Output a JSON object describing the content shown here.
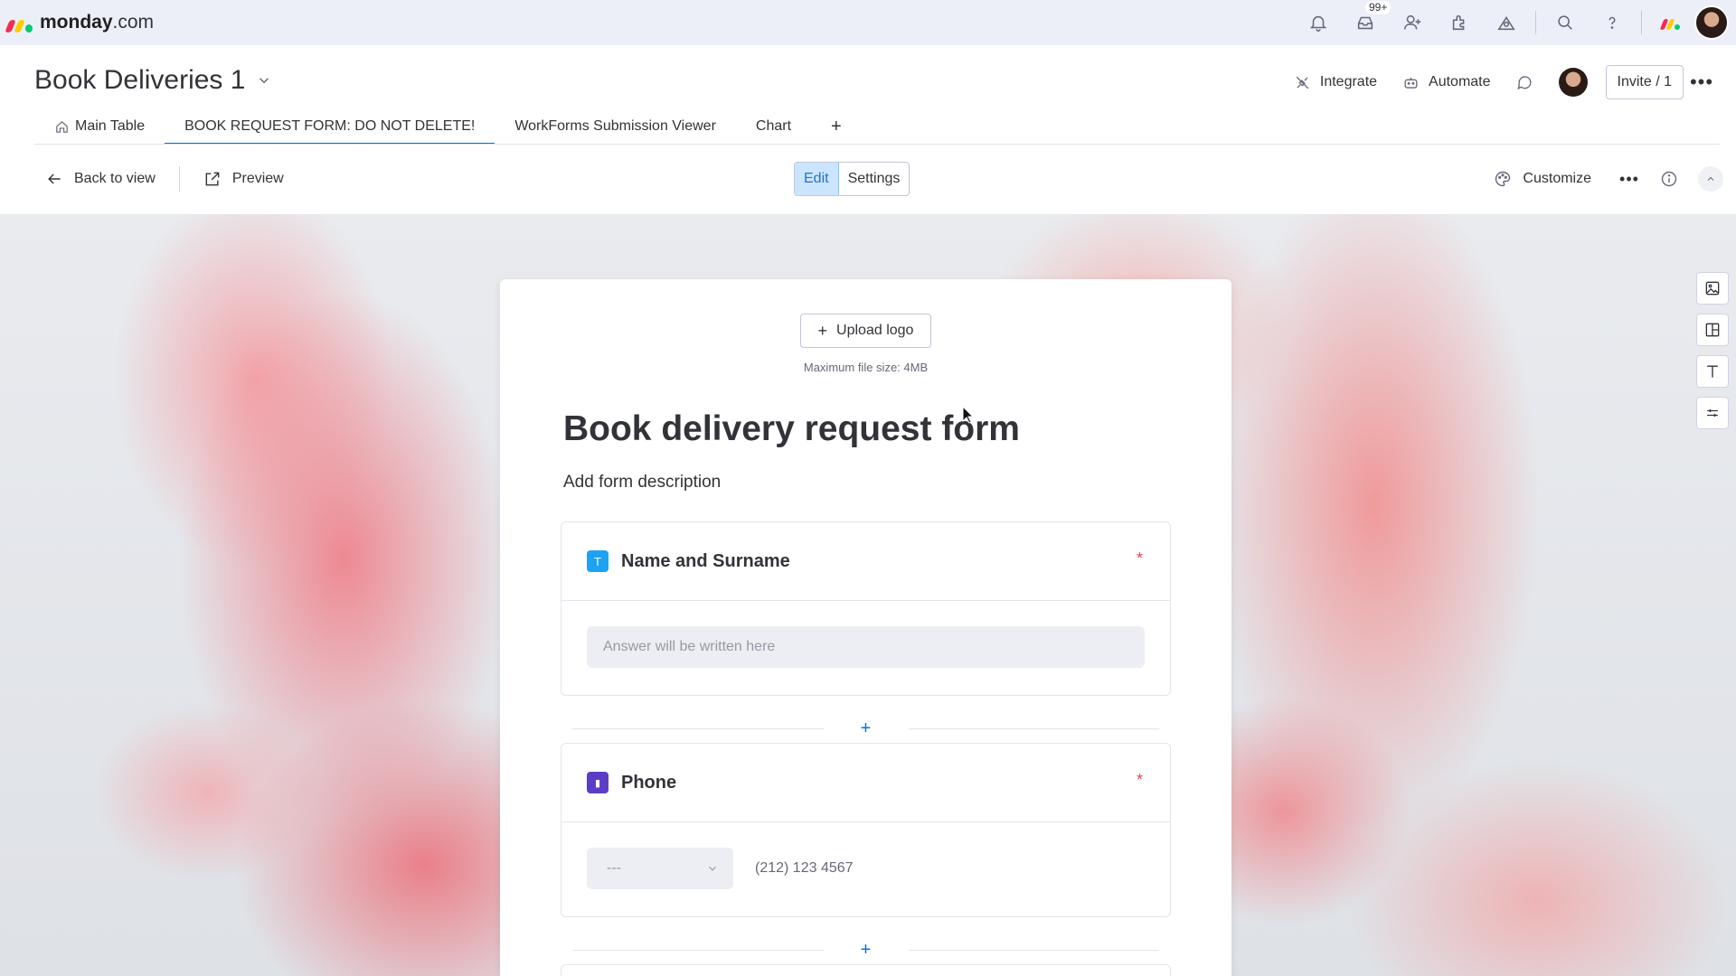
{
  "app": {
    "brand_name": "monday",
    "brand_suffix": ".com",
    "notifications_badge": "99+"
  },
  "board": {
    "title": "Book Deliveries 1",
    "actions": {
      "integrate": "Integrate",
      "automate": "Automate",
      "invite": "Invite / 1"
    }
  },
  "tabs": [
    {
      "label": "Main Table",
      "icon": "home-icon",
      "active": false
    },
    {
      "label": "BOOK REQUEST FORM: DO NOT DELETE!",
      "active": true
    },
    {
      "label": "WorkForms Submission Viewer",
      "active": false
    },
    {
      "label": "Chart",
      "active": false
    },
    {
      "label": "+",
      "active": false
    }
  ],
  "toolbar": {
    "back": "Back to view",
    "preview": "Preview",
    "edit": "Edit",
    "settings": "Settings",
    "customize": "Customize"
  },
  "form": {
    "upload_logo": "Upload logo",
    "max_file_size": "Maximum file size: 4MB",
    "title": "Book delivery request form",
    "description": "Add form description",
    "questions": [
      {
        "label": "Name and Surname",
        "required_mark": "*",
        "placeholder": "Answer will be written here",
        "icon_color": "#1ca3f4",
        "icon_glyph": "T"
      },
      {
        "label": "Phone",
        "required_mark": "*",
        "country_placeholder": "---",
        "phone_placeholder": "(212) 123 4567",
        "icon_color": "#5b3ec8",
        "icon_glyph": "▮"
      }
    ]
  },
  "colors": {
    "accent": "#0073ea",
    "required": "#e2445c",
    "topbar_bg": "#eceff8"
  }
}
